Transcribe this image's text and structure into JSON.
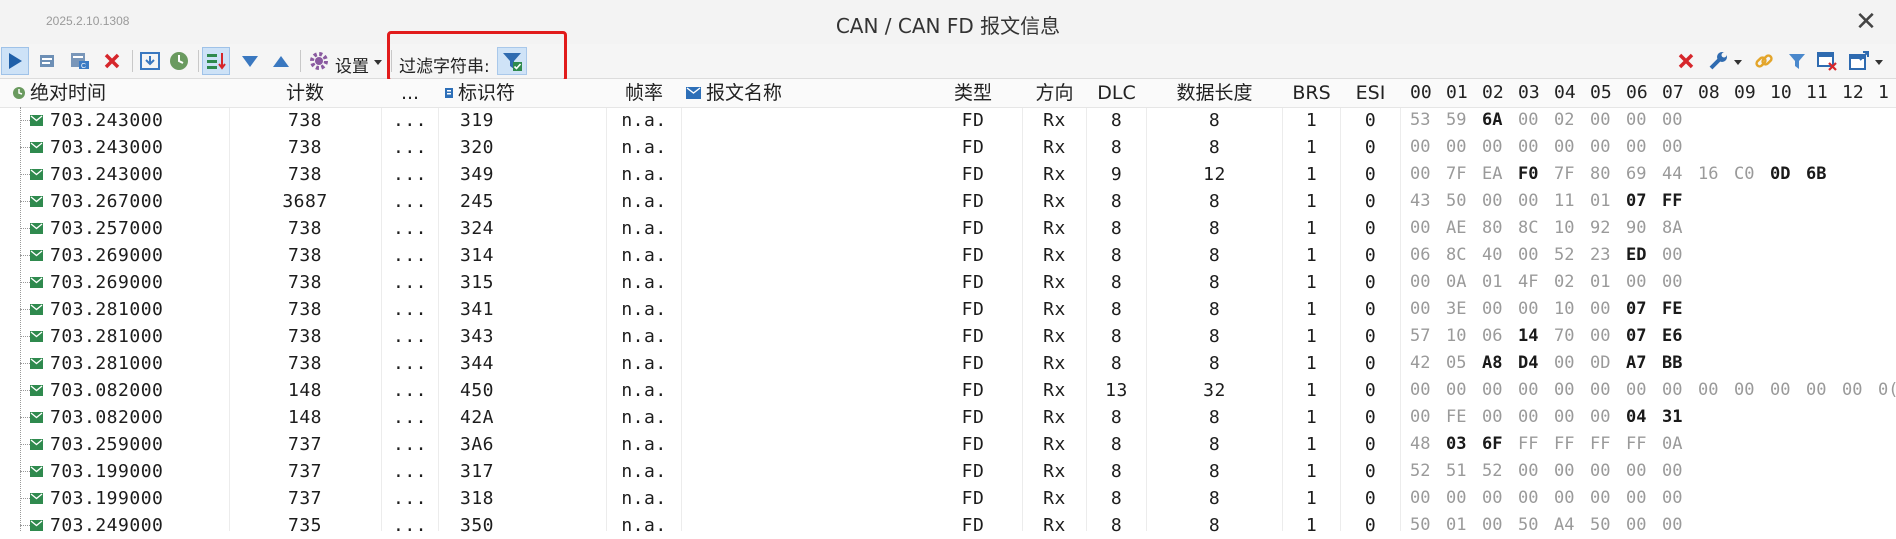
{
  "window": {
    "version": "2025.2.10.1308",
    "title": "CAN / CAN FD 报文信息",
    "close_glyph": "✕"
  },
  "toolbar": {
    "settings_label": "设置",
    "filter_label": "过滤字符串:"
  },
  "columns": {
    "abs_time": "绝对时间",
    "count": "计数",
    "more": "...",
    "identifier": "标识符",
    "frame_rate": "帧率",
    "msg_name": "报文名称",
    "type": "类型",
    "direction": "方向",
    "dlc": "DLC",
    "data_len": "数据长度",
    "brs": "BRS",
    "esi": "ESI",
    "byte_headers": [
      "00",
      "01",
      "02",
      "03",
      "04",
      "05",
      "06",
      "07",
      "08",
      "09",
      "10",
      "11",
      "12",
      "1"
    ]
  },
  "rows": [
    {
      "time": "703.243000",
      "count": "738",
      "more": "...",
      "id": "319",
      "rate": "n.a.",
      "name": "",
      "type": "FD",
      "dir": "Rx",
      "dlc": "8",
      "len": "8",
      "brs": "1",
      "esi": "0",
      "data": [
        "53",
        "59",
        "6A",
        "00",
        "02",
        "00",
        "00",
        "00"
      ],
      "hi": [
        2
      ]
    },
    {
      "time": "703.243000",
      "count": "738",
      "more": "...",
      "id": "320",
      "rate": "n.a.",
      "name": "",
      "type": "FD",
      "dir": "Rx",
      "dlc": "8",
      "len": "8",
      "brs": "1",
      "esi": "0",
      "data": [
        "00",
        "00",
        "00",
        "00",
        "00",
        "00",
        "00",
        "00"
      ],
      "hi": []
    },
    {
      "time": "703.243000",
      "count": "738",
      "more": "...",
      "id": "349",
      "rate": "n.a.",
      "name": "",
      "type": "FD",
      "dir": "Rx",
      "dlc": "9",
      "len": "12",
      "brs": "1",
      "esi": "0",
      "data": [
        "00",
        "7F",
        "EA",
        "F0",
        "7F",
        "80",
        "69",
        "44",
        "16",
        "C0",
        "0D",
        "6B"
      ],
      "hi": [
        3,
        10,
        11
      ]
    },
    {
      "time": "703.267000",
      "count": "3687",
      "more": "...",
      "id": "245",
      "rate": "n.a.",
      "name": "",
      "type": "FD",
      "dir": "Rx",
      "dlc": "8",
      "len": "8",
      "brs": "1",
      "esi": "0",
      "data": [
        "43",
        "50",
        "00",
        "00",
        "11",
        "01",
        "07",
        "FF"
      ],
      "hi": [
        6,
        7
      ]
    },
    {
      "time": "703.257000",
      "count": "738",
      "more": "...",
      "id": "324",
      "rate": "n.a.",
      "name": "",
      "type": "FD",
      "dir": "Rx",
      "dlc": "8",
      "len": "8",
      "brs": "1",
      "esi": "0",
      "data": [
        "00",
        "AE",
        "80",
        "8C",
        "10",
        "92",
        "90",
        "8A"
      ],
      "hi": []
    },
    {
      "time": "703.269000",
      "count": "738",
      "more": "...",
      "id": "314",
      "rate": "n.a.",
      "name": "",
      "type": "FD",
      "dir": "Rx",
      "dlc": "8",
      "len": "8",
      "brs": "1",
      "esi": "0",
      "data": [
        "06",
        "8C",
        "40",
        "00",
        "52",
        "23",
        "ED",
        "00"
      ],
      "hi": [
        6
      ]
    },
    {
      "time": "703.269000",
      "count": "738",
      "more": "...",
      "id": "315",
      "rate": "n.a.",
      "name": "",
      "type": "FD",
      "dir": "Rx",
      "dlc": "8",
      "len": "8",
      "brs": "1",
      "esi": "0",
      "data": [
        "00",
        "0A",
        "01",
        "4F",
        "02",
        "01",
        "00",
        "00"
      ],
      "hi": []
    },
    {
      "time": "703.281000",
      "count": "738",
      "more": "...",
      "id": "341",
      "rate": "n.a.",
      "name": "",
      "type": "FD",
      "dir": "Rx",
      "dlc": "8",
      "len": "8",
      "brs": "1",
      "esi": "0",
      "data": [
        "00",
        "3E",
        "00",
        "00",
        "10",
        "00",
        "07",
        "FE"
      ],
      "hi": [
        6,
        7
      ]
    },
    {
      "time": "703.281000",
      "count": "738",
      "more": "...",
      "id": "343",
      "rate": "n.a.",
      "name": "",
      "type": "FD",
      "dir": "Rx",
      "dlc": "8",
      "len": "8",
      "brs": "1",
      "esi": "0",
      "data": [
        "57",
        "10",
        "06",
        "14",
        "70",
        "00",
        "07",
        "E6"
      ],
      "hi": [
        3,
        6,
        7
      ]
    },
    {
      "time": "703.281000",
      "count": "738",
      "more": "...",
      "id": "344",
      "rate": "n.a.",
      "name": "",
      "type": "FD",
      "dir": "Rx",
      "dlc": "8",
      "len": "8",
      "brs": "1",
      "esi": "0",
      "data": [
        "42",
        "05",
        "A8",
        "D4",
        "00",
        "0D",
        "A7",
        "BB"
      ],
      "hi": [
        2,
        3,
        6,
        7
      ]
    },
    {
      "time": "703.082000",
      "count": "148",
      "more": "...",
      "id": "450",
      "rate": "n.a.",
      "name": "",
      "type": "FD",
      "dir": "Rx",
      "dlc": "13",
      "len": "32",
      "brs": "1",
      "esi": "0",
      "data": [
        "00",
        "00",
        "00",
        "00",
        "00",
        "00",
        "00",
        "00",
        "00",
        "00",
        "00",
        "00",
        "00",
        "0("
      ],
      "hi": []
    },
    {
      "time": "703.082000",
      "count": "148",
      "more": "...",
      "id": "42A",
      "rate": "n.a.",
      "name": "",
      "type": "FD",
      "dir": "Rx",
      "dlc": "8",
      "len": "8",
      "brs": "1",
      "esi": "0",
      "data": [
        "00",
        "FE",
        "00",
        "00",
        "00",
        "00",
        "04",
        "31"
      ],
      "hi": [
        6,
        7
      ]
    },
    {
      "time": "703.259000",
      "count": "737",
      "more": "...",
      "id": "3A6",
      "rate": "n.a.",
      "name": "",
      "type": "FD",
      "dir": "Rx",
      "dlc": "8",
      "len": "8",
      "brs": "1",
      "esi": "0",
      "data": [
        "48",
        "03",
        "6F",
        "FF",
        "FF",
        "FF",
        "FF",
        "0A"
      ],
      "hi": [
        1,
        2
      ]
    },
    {
      "time": "703.199000",
      "count": "737",
      "more": "...",
      "id": "317",
      "rate": "n.a.",
      "name": "",
      "type": "FD",
      "dir": "Rx",
      "dlc": "8",
      "len": "8",
      "brs": "1",
      "esi": "0",
      "data": [
        "52",
        "51",
        "52",
        "00",
        "00",
        "00",
        "00",
        "00"
      ],
      "hi": []
    },
    {
      "time": "703.199000",
      "count": "737",
      "more": "...",
      "id": "318",
      "rate": "n.a.",
      "name": "",
      "type": "FD",
      "dir": "Rx",
      "dlc": "8",
      "len": "8",
      "brs": "1",
      "esi": "0",
      "data": [
        "00",
        "00",
        "00",
        "00",
        "00",
        "00",
        "00",
        "00"
      ],
      "hi": []
    },
    {
      "time": "703.249000",
      "count": "735",
      "more": "...",
      "id": "350",
      "rate": "n.a.",
      "name": "",
      "type": "FD",
      "dir": "Rx",
      "dlc": "8",
      "len": "8",
      "brs": "1",
      "esi": "0",
      "data": [
        "50",
        "01",
        "00",
        "50",
        "A4",
        "50",
        "00",
        "00"
      ],
      "hi": []
    }
  ],
  "colors": {
    "highlight_box": "#e11b1b",
    "icon_green": "#2f8a4e",
    "icon_blue": "#2d6fb8",
    "icon_red": "#d6262b"
  }
}
